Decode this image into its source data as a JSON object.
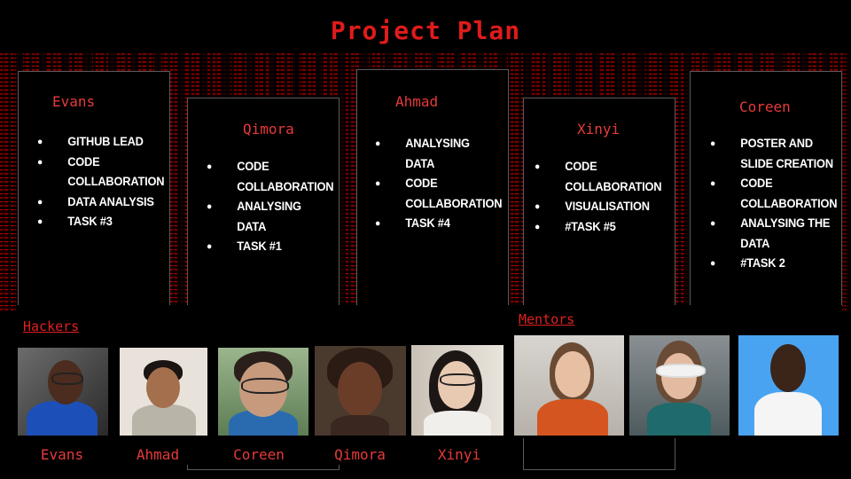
{
  "title": "Project Plan",
  "cards": [
    {
      "name": "Evans",
      "tasks": [
        "GITHUB LEAD",
        "CODE COLLABORATION",
        "DATA ANALYSIS",
        "TASK #3"
      ]
    },
    {
      "name": "Qimora",
      "tasks": [
        "CODE COLLABORATION",
        "ANALYSING DATA",
        "TASK #1"
      ]
    },
    {
      "name": "Ahmad",
      "tasks": [
        "ANALYSING DATA",
        "CODE COLLABORATION",
        "TASK #4"
      ]
    },
    {
      "name": "Xinyi",
      "tasks": [
        "CODE COLLABORATION",
        "VISUALISATION",
        "#TASK #5"
      ]
    },
    {
      "name": "Coreen",
      "tasks": [
        "POSTER AND SLIDE CREATION",
        "CODE COLLABORATION",
        "ANALYSING THE DATA",
        "#TASK 2"
      ]
    }
  ],
  "hackers_label": "Hackers",
  "mentors_label": "Mentors",
  "hackers": [
    "Evans",
    "Ahmad",
    "Coreen",
    "Qimora",
    "Xinyi"
  ],
  "bullet_icon": "bullet-dot",
  "colors": {
    "accent": "#e01b1b",
    "background": "#000000",
    "text": "#ffffff"
  }
}
